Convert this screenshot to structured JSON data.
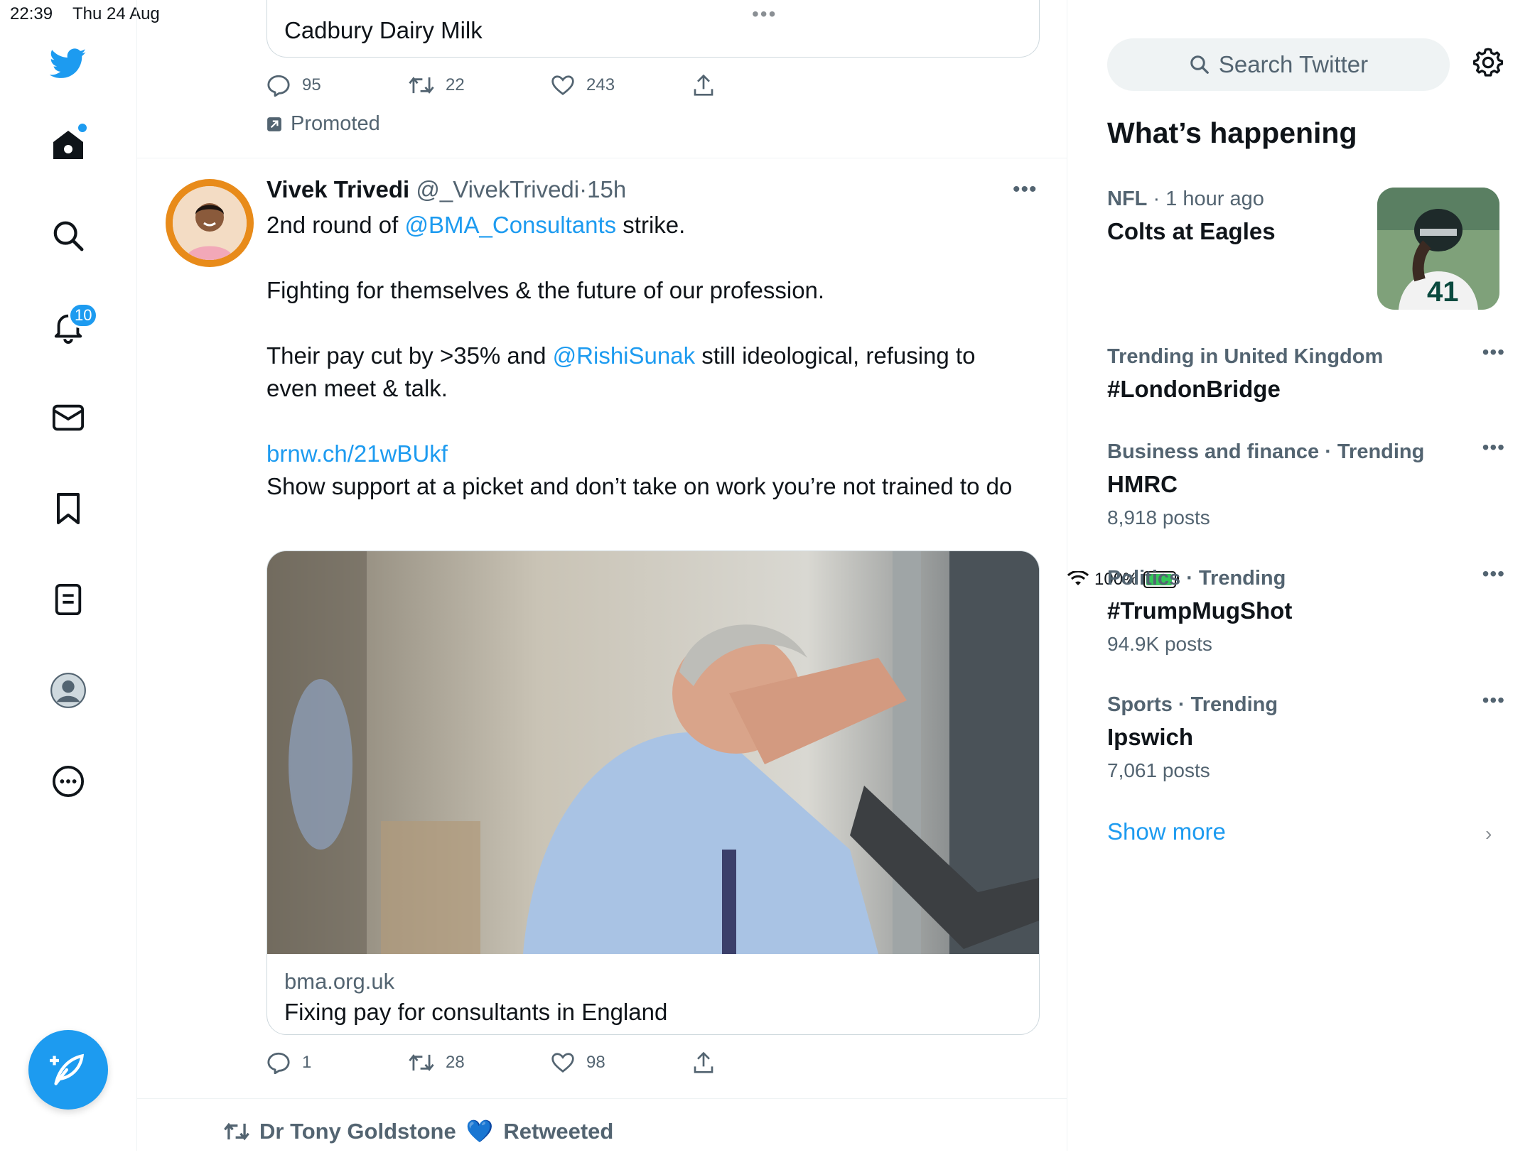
{
  "status": {
    "time": "22:39",
    "date": "Thu 24 Aug",
    "multitask": "•••",
    "battery": "100%"
  },
  "nav": {
    "notifications_badge": "10"
  },
  "promo": {
    "card_text": "Cadbury Dairy Milk",
    "replies": "95",
    "retweets": "22",
    "likes": "243",
    "label": "Promoted"
  },
  "tweet": {
    "name": "Vivek Trivedi",
    "handle": "@_VivekTrivedi",
    "separator": "·",
    "time": "15h",
    "more": "•••",
    "line1_pre": "2nd round of ",
    "line1_mention": "@BMA_Consultants",
    "line1_post": " strike.",
    "line2": "Fighting for themselves & the future of our profession.",
    "line3_pre": "Their pay cut by >35% and ",
    "line3_mention": "@RishiSunak",
    "line3_post": " still ideological, refusing to even meet & talk.",
    "link": "brnw.ch/21wBUkf",
    "line4": "Show support at a picket and don’t take on work you’re not trained to do",
    "card_domain": "bma.org.uk",
    "card_title": "Fixing pay for consultants in England",
    "replies": "1",
    "retweets": "28",
    "likes": "98"
  },
  "retweet_line": {
    "name": "Dr Tony Goldstone",
    "heart": "💙",
    "label": "Retweeted"
  },
  "sidebar": {
    "search_placeholder": "Search Twitter",
    "title": "What’s happening",
    "trends": [
      {
        "category": "NFL",
        "sep": "·",
        "time": "1 hour ago",
        "topic": "Colts at Eagles"
      },
      {
        "context": "Trending in United Kingdom",
        "topic": "#LondonBridge",
        "more": "•••"
      },
      {
        "context": "Business and finance · Trending",
        "topic": "HMRC",
        "count": "8,918 posts",
        "more": "•••"
      },
      {
        "context": "Politics · Trending",
        "topic": "#TrumpMugShot",
        "count": "94.9K posts",
        "more": "•••"
      },
      {
        "context": "Sports · Trending",
        "topic": "Ipswich",
        "count": "7,061 posts",
        "more": "•••"
      }
    ],
    "show_more": "Show more",
    "chevron": "›"
  },
  "colors": {
    "accent": "#1d9bf0",
    "text": "#0f1419",
    "secondary": "#536471",
    "border": "#cfd9de"
  },
  "icons": [
    "twitter-bird-icon",
    "home-icon",
    "explore-search-icon",
    "bell-icon",
    "mail-icon",
    "bookmark-icon",
    "lists-icon",
    "profile-icon",
    "more-circle-icon",
    "compose-icon",
    "reply-icon",
    "retweet-icon",
    "like-icon",
    "share-icon",
    "gear-icon",
    "wifi-icon",
    "battery-icon"
  ]
}
